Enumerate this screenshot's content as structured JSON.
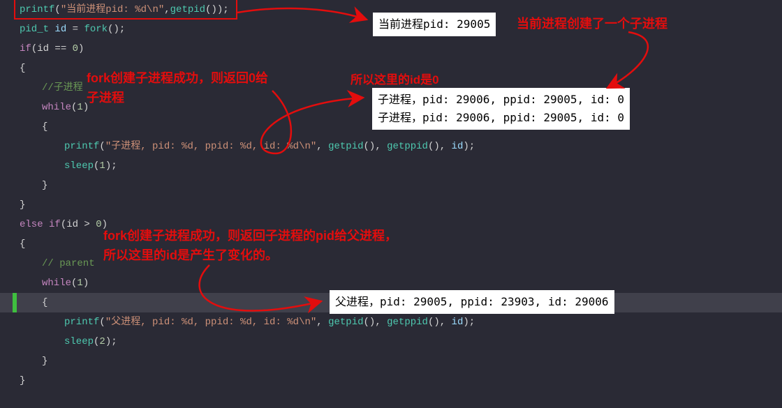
{
  "code": {
    "l1_printf": "printf",
    "l1_str": "\"当前进程pid: %d\\n\"",
    "l1_getpid": "getpid",
    "l2_type": "pid_t",
    "l2_id": "id",
    "l2_fork": "fork",
    "l3_if": "if",
    "l3_cond": "(id == ",
    "l3_zero": "0",
    "l3_close": ")",
    "l4_brace": "{",
    "l5_comment": "//子进程",
    "l6_while": "while",
    "l6_one": "1",
    "l7_brace": "{",
    "l8_printf": "printf",
    "l8_str": "\"子进程, pid: %d, ppid: %d, id: %d\\n\"",
    "l8_getpid": "getpid",
    "l8_getppid": "getppid",
    "l8_id": "id",
    "l9_sleep": "sleep",
    "l9_one": "1",
    "l10_brace": "}",
    "l11_brace": "}",
    "l12_else": "else if",
    "l12_cond": "(id > ",
    "l12_zero": "0",
    "l12_close": ")",
    "l13_brace": "{",
    "l14_comment": "// parent",
    "l15_while": "while",
    "l15_one": "1",
    "l16_brace": "{",
    "l17_printf": "printf",
    "l17_str": "\"父进程, pid: %d, ppid: %d, id: %d\\n\"",
    "l17_getpid": "getpid",
    "l17_getppid": "getppid",
    "l17_id": "id",
    "l18_sleep": "sleep",
    "l18_two": "2",
    "l19_brace": "}",
    "l20_brace": "}"
  },
  "annotations": {
    "a1": "当前进程创建了一个子进程",
    "a2_line1": "fork创建子进程成功，则返回0给",
    "a2_line2": "子进程",
    "a3": "所以这里的id是0",
    "a4_line1": "fork创建子进程成功，则返回子进程的pid给父进程，",
    "a4_line2": "所以这里的id是产生了变化的。"
  },
  "outputs": {
    "o1": "当前进程pid: 29005",
    "o2_l1": "子进程，pid: 29006, ppid: 29005, id: 0",
    "o2_l2": "子进程，pid: 29006, ppid: 29005, id: 0",
    "o3": "父进程，pid: 29005, ppid: 23903, id: 29006"
  }
}
